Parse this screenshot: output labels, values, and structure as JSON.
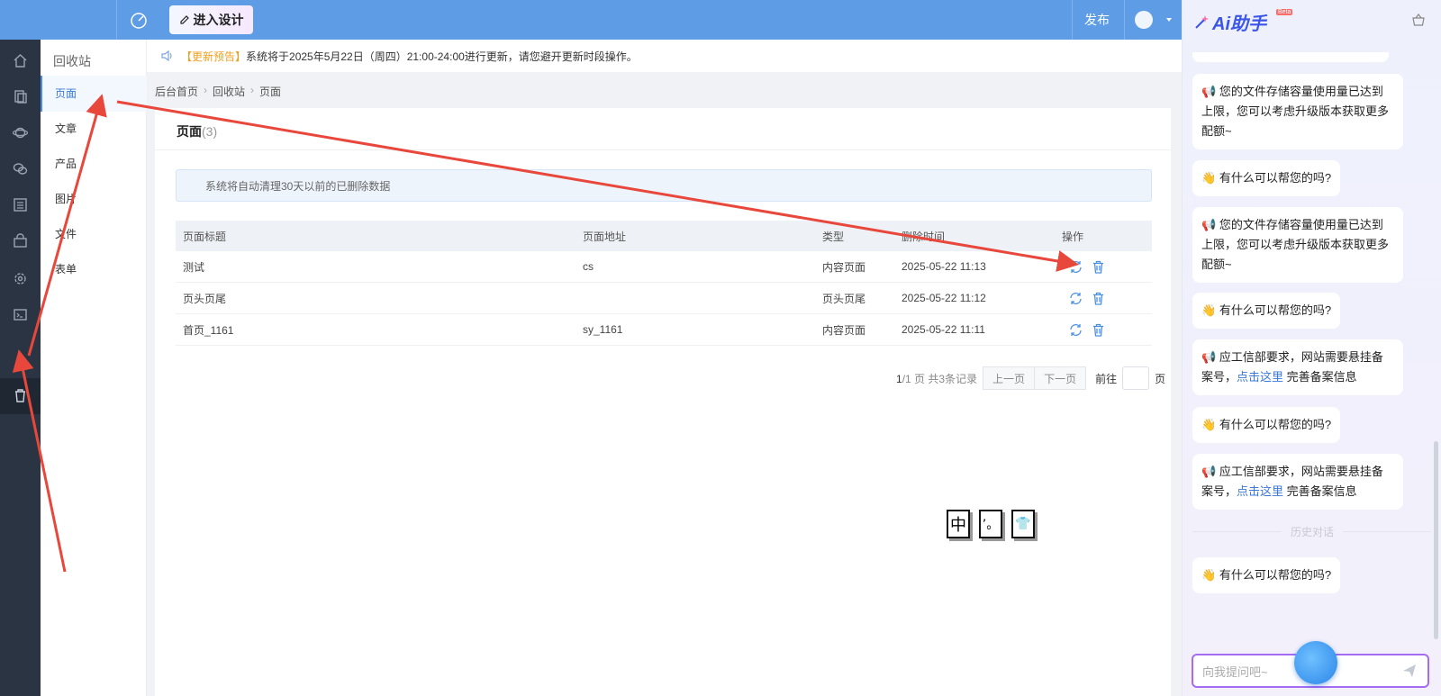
{
  "topbar": {
    "design_label": "进入设计",
    "publish_label": "发布"
  },
  "subnav": {
    "title": "回收站",
    "items": [
      {
        "label": "页面"
      },
      {
        "label": "文章"
      },
      {
        "label": "产品"
      },
      {
        "label": "图片"
      },
      {
        "label": "文件"
      },
      {
        "label": "表单"
      }
    ]
  },
  "notice": {
    "highlight": "【更新预告】",
    "text": "系统将于2025年5月22日（周四）21:00-24:00进行更新，请您避开更新时段操作。"
  },
  "breadcrumb": [
    "后台首页",
    "回收站",
    "页面"
  ],
  "panel": {
    "title": "页面",
    "count": "(3)",
    "alert": "系统将自动清理30天以前的已删除数据"
  },
  "table": {
    "headers": [
      "页面标题",
      "页面地址",
      "类型",
      "删除时间",
      "操作"
    ],
    "rows": [
      {
        "title": "测试",
        "url": "cs",
        "type": "内容页面",
        "time": "2025-05-22 11:13"
      },
      {
        "title": "页头页尾",
        "url": "",
        "type": "页头页尾",
        "time": "2025-05-22 11:12"
      },
      {
        "title": "首页_1161",
        "url": "sy_1161",
        "type": "内容页面",
        "time": "2025-05-22 11:11"
      }
    ]
  },
  "pager": {
    "current": "1",
    "total_text": "/1 页 共3条记录",
    "prev": "上一页",
    "next": "下一页",
    "goto": "前往",
    "page_unit": "页"
  },
  "ime": {
    "k1": "中",
    "k2": "’。",
    "k3": "👕"
  },
  "assistant": {
    "logo_text": "Ai助手",
    "beta": "Beta",
    "messages": {
      "m1": "您的文件存储容量使用量已达到上限，您可以考虑升级版本获取更多配额~",
      "m2": "有什么可以帮您的吗?",
      "m3": "您的文件存储容量使用量已达到上限，您可以考虑升级版本获取更多配额~",
      "m4": "有什么可以帮您的吗?",
      "m5a": "应工信部要求，网站需要悬挂备案号，",
      "m5link": "点击这里",
      "m5b": "完善备案信息",
      "m6": "有什么可以帮您的吗?",
      "m7a": "应工信部要求，网站需要悬挂备案号，",
      "m7link": "点击这里",
      "m7b": "完善备案信息",
      "m8": "有什么可以帮您的吗?"
    },
    "history_label": "历史对话",
    "input_placeholder": "向我提问吧~"
  },
  "colors": {
    "topbar": "#5e9de6",
    "sidebar": "#2b3442",
    "accent": "#4a90e2",
    "arrow": "#e8473c"
  }
}
